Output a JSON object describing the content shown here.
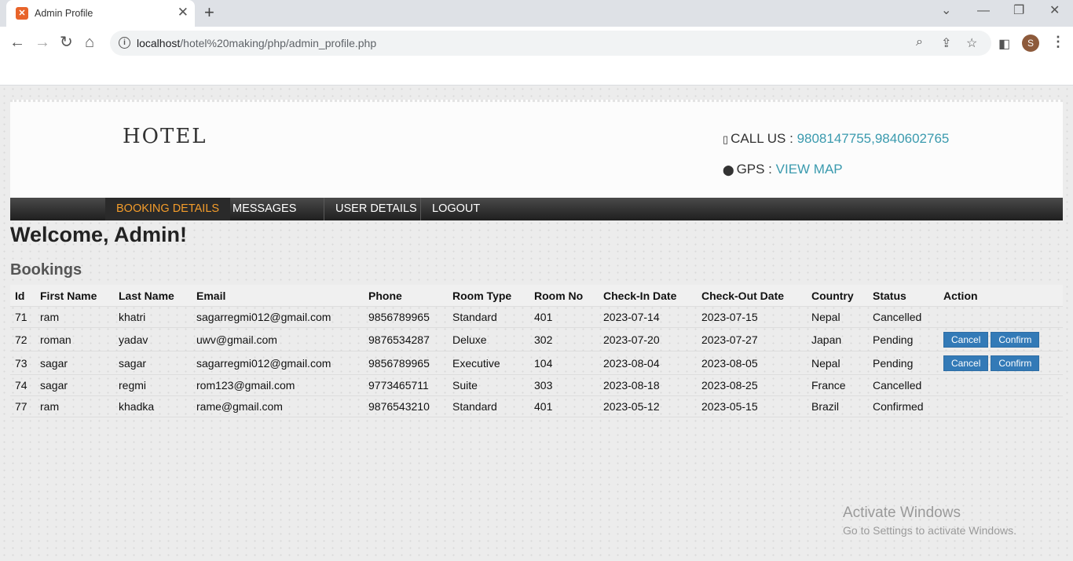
{
  "browser": {
    "tab_title": "Admin Profile",
    "tab_close": "✕",
    "new_tab": "+",
    "url_host": "localhost",
    "url_path": "/hotel%20making/php/admin_profile.php",
    "profile_initial": "S"
  },
  "header": {
    "logo": "HOTEL",
    "call_label": "CALL US : ",
    "call_value": "9808147755,9840602765",
    "gps_label": "GPS : ",
    "gps_value": "VIEW MAP"
  },
  "nav": {
    "items": [
      {
        "label": "BOOKING DETAILS"
      },
      {
        "label": "MESSAGES"
      },
      {
        "label": "USER DETAILS"
      },
      {
        "label": "LOGOUT"
      }
    ]
  },
  "main": {
    "welcome": "Welcome, Admin!",
    "section_title": "Bookings"
  },
  "table": {
    "headers": [
      "Id",
      "First Name",
      "Last Name",
      "Email",
      "Phone",
      "Room Type",
      "Room No",
      "Check-In Date",
      "Check-Out Date",
      "Country",
      "Status",
      "Action"
    ],
    "rows": [
      [
        "71",
        "ram",
        "khatri",
        "sagarregmi012@gmail.com",
        "9856789965",
        "Standard",
        "401",
        "2023-07-14",
        "2023-07-15",
        "Nepal",
        "Cancelled"
      ],
      [
        "72",
        "roman",
        "yadav",
        "uwv@gmail.com",
        "9876534287",
        "Deluxe",
        "302",
        "2023-07-20",
        "2023-07-27",
        "Japan",
        "Pending"
      ],
      [
        "73",
        "sagar",
        "sagar",
        "sagarregmi012@gmail.com",
        "9856789965",
        "Executive",
        "104",
        "2023-08-04",
        "2023-08-05",
        "Nepal",
        "Pending"
      ],
      [
        "74",
        "sagar",
        "regmi",
        "rom123@gmail.com",
        "9773465711",
        "Suite",
        "303",
        "2023-08-18",
        "2023-08-25",
        "France",
        "Cancelled"
      ],
      [
        "77",
        "ram",
        "khadka",
        "rame@gmail.com",
        "9876543210",
        "Standard",
        "401",
        "2023-05-12",
        "2023-05-15",
        "Brazil",
        "Confirmed"
      ]
    ],
    "cancel_label": "Cancel",
    "confirm_label": "Confirm"
  },
  "watermark": {
    "line1": "Activate Windows",
    "line2": "Go to Settings to activate Windows."
  }
}
